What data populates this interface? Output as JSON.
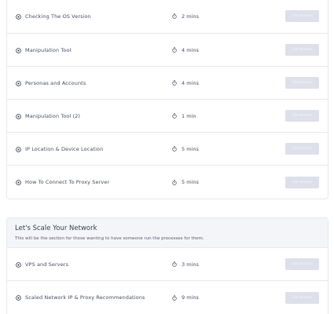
{
  "lessons_top": [
    {
      "title": "Checking The OS Version",
      "duration": "2 mins",
      "action": "Get access"
    },
    {
      "title": "Manipulation Tool",
      "duration": "4 mins",
      "action": "Get access"
    },
    {
      "title": "Personas and Accounts",
      "duration": "4 mins",
      "action": "Get access"
    },
    {
      "title": "Manipulation Tool (2)",
      "duration": "1 min",
      "action": "Get access"
    },
    {
      "title": "IP Location & Device Location",
      "duration": "5 mins",
      "action": "Get access"
    },
    {
      "title": "How To Connect To Proxy Server",
      "duration": "5 mins",
      "action": "Get access"
    }
  ],
  "section": {
    "title": "Let's Scale Your Network",
    "description": "This will be the section for those wanting to have someone run the processes for them.",
    "lessons": [
      {
        "title": "VPS and Servers",
        "duration": "3 mins",
        "action": "Get access"
      },
      {
        "title": "Scaled Network IP & Proxy Recommendations",
        "duration": "9 mins",
        "action": "Get access"
      }
    ]
  },
  "colors": {
    "text": "#4a4f63",
    "button_bg": "#dde0ea",
    "section_bg": "#f4f5f9",
    "border": "#e8e9ee"
  },
  "icons": {
    "lesson": "play-circle-icon",
    "duration": "timer-icon"
  }
}
